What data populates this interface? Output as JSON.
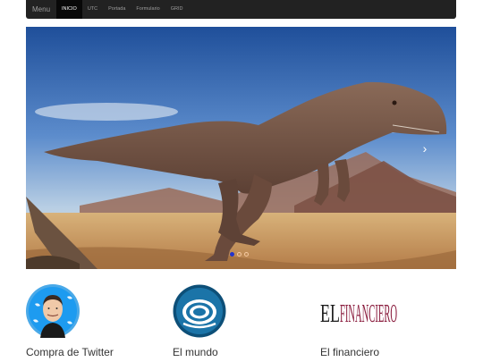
{
  "navbar": {
    "brand": "Menu",
    "items": [
      {
        "label": "INICIO",
        "active": true
      },
      {
        "label": "UTC",
        "active": false
      },
      {
        "label": "Portada",
        "active": false
      },
      {
        "label": "Formulario",
        "active": false
      },
      {
        "label": "GRID",
        "active": false
      }
    ]
  },
  "carousel": {
    "next_icon": "chevron-right-icon",
    "indicator_count": 3,
    "active_index": 0
  },
  "cards": [
    {
      "title": "Compra de Twitter",
      "icon": "elon-twitter-avatar"
    },
    {
      "title": "El mundo",
      "icon": "el-mundo-logo"
    },
    {
      "title": "El financiero",
      "icon": "el-financiero-logo",
      "logo_text_1": "EL",
      "logo_text_2": "FINANCIERO"
    }
  ],
  "colors": {
    "navbar_bg": "#222222",
    "navbar_active_bg": "#080808",
    "indicator_active": "#2233cc",
    "financiero_red": "#8b1e3f"
  }
}
